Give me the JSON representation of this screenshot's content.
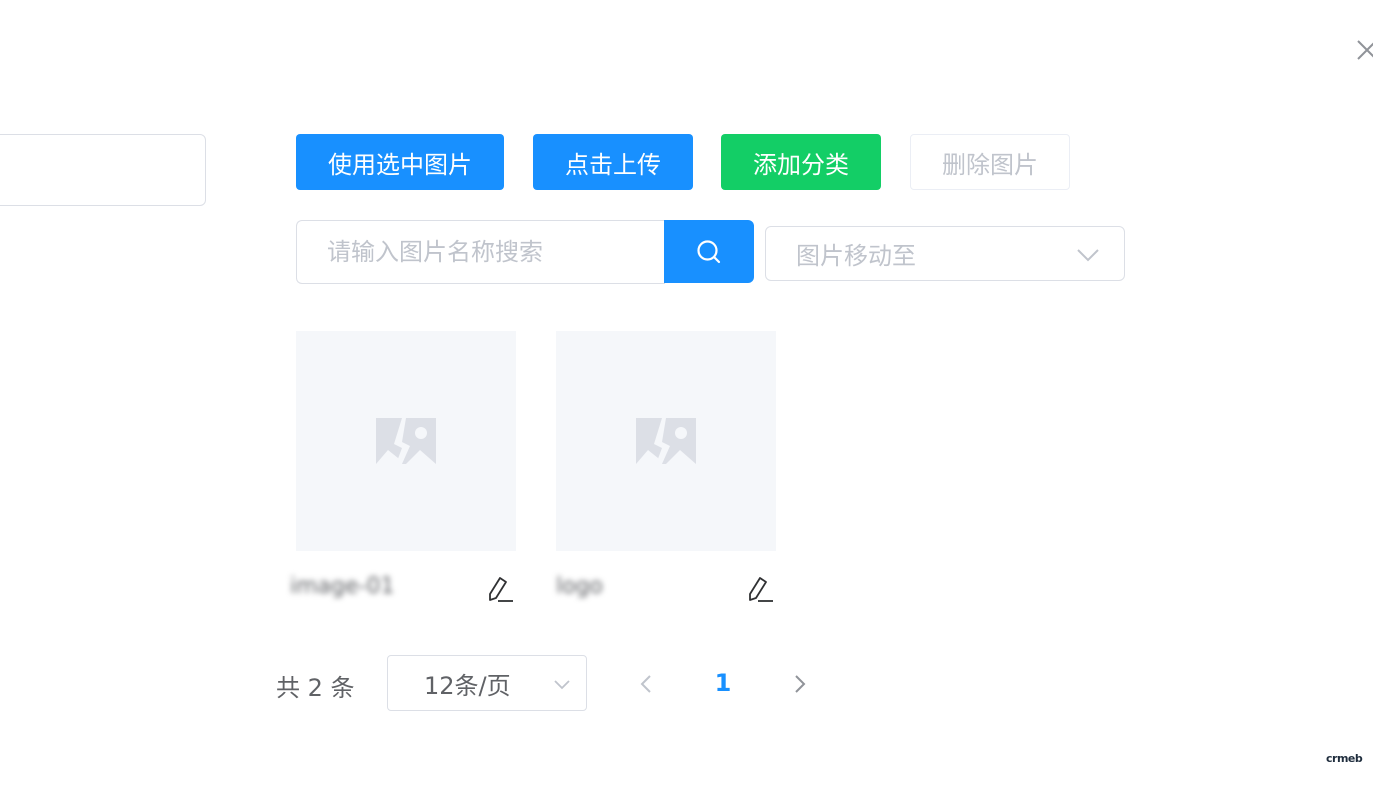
{
  "dialog": {
    "close_icon": "close-icon"
  },
  "toolbar": {
    "use_selected_label": "使用选中图片",
    "upload_label": "点击上传",
    "add_category_label": "添加分类",
    "delete_label": "删除图片"
  },
  "search": {
    "placeholder": "请输入图片名称搜索",
    "value": "",
    "button_icon": "search-icon"
  },
  "move_to": {
    "placeholder": "图片移动至",
    "icon": "chevron-down-icon"
  },
  "images": [
    {
      "name": "image-01",
      "thumb_icon": "image-placeholder-icon",
      "edit_icon": "edit-icon"
    },
    {
      "name": "logo",
      "thumb_icon": "image-placeholder-icon",
      "edit_icon": "edit-icon"
    }
  ],
  "pagination": {
    "total_text": "共 2 条",
    "page_size_text": "12条/页",
    "current_page": "1",
    "prev_icon": "chevron-left-icon",
    "next_icon": "chevron-right-icon"
  },
  "brand": {
    "text": "crmeb"
  },
  "colors": {
    "primary": "#1890ff",
    "success": "#13ce66",
    "disabled_text": "#c0c4cc",
    "border": "#dcdfe6",
    "placeholder_bg": "#f5f7fa"
  }
}
